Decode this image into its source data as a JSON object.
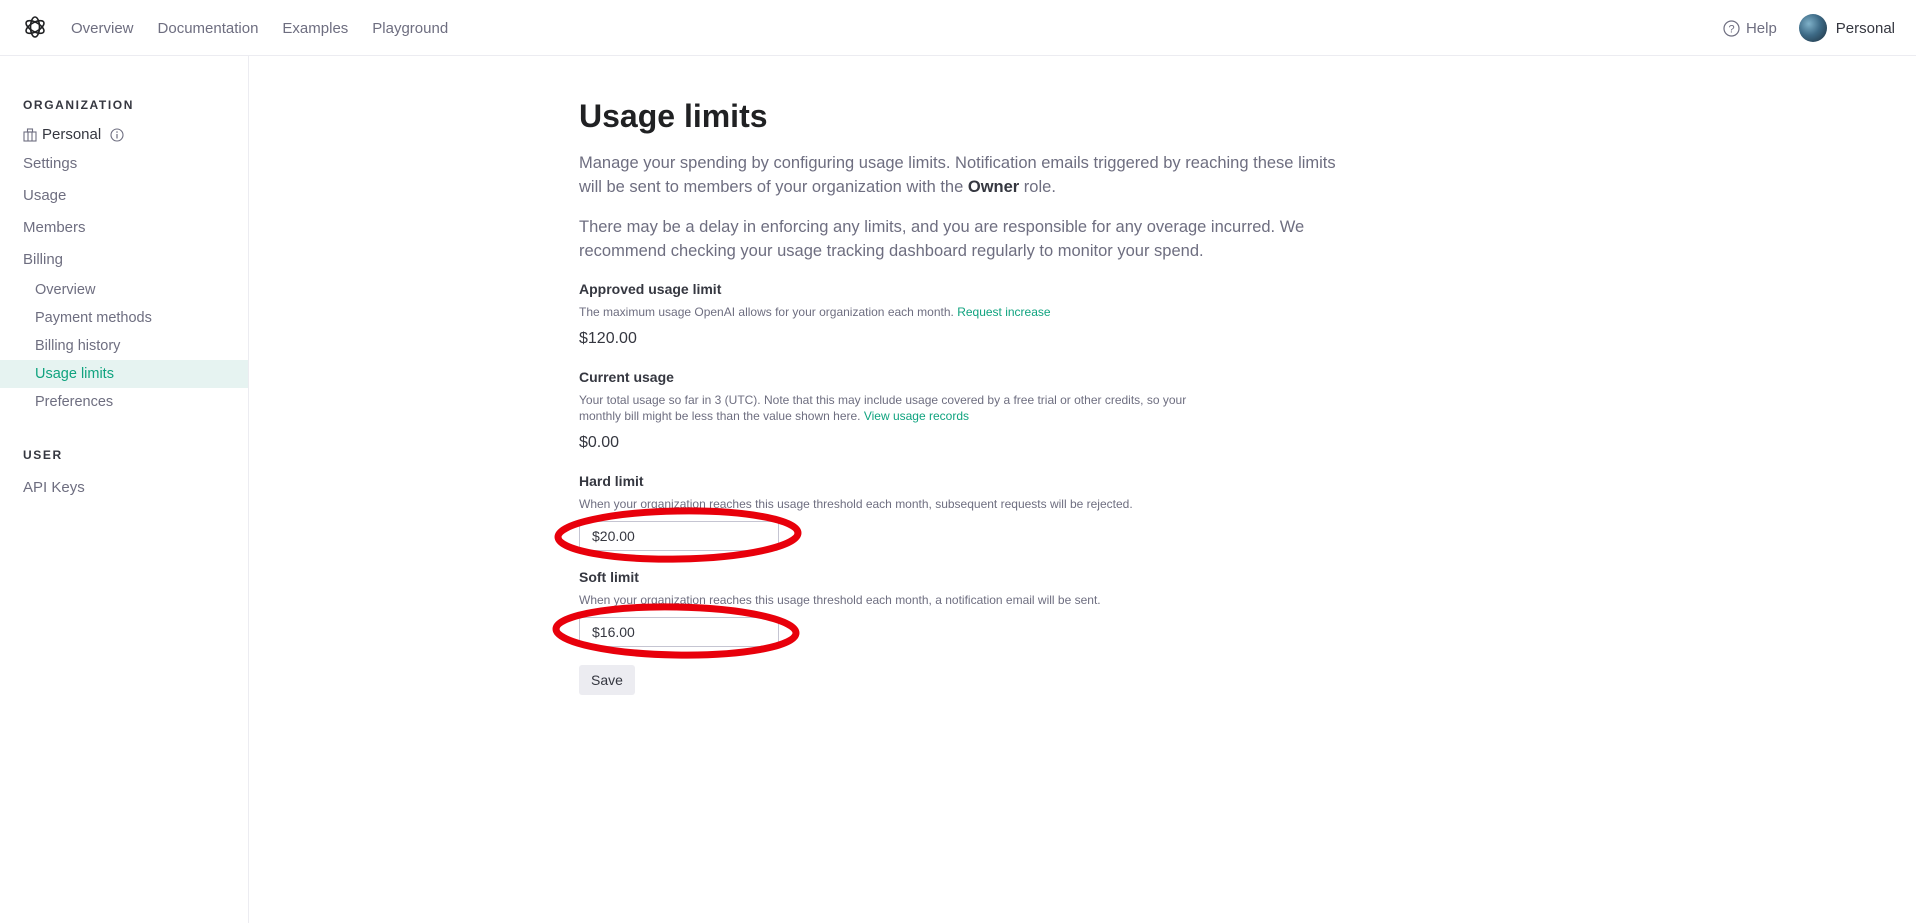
{
  "nav": {
    "links": [
      "Overview",
      "Documentation",
      "Examples",
      "Playground"
    ],
    "help": "Help",
    "account": "Personal"
  },
  "sidebar": {
    "org_title": "ORGANIZATION",
    "org_name": "Personal",
    "items": [
      "Settings",
      "Usage",
      "Members",
      "Billing"
    ],
    "billing_items": [
      "Overview",
      "Payment methods",
      "Billing history",
      "Usage limits",
      "Preferences"
    ],
    "active_item": "Usage limits",
    "user_title": "USER",
    "user_items": [
      "API Keys"
    ]
  },
  "page": {
    "title": "Usage limits",
    "intro_1_a": "Manage your spending by configuring usage limits. Notification emails triggered by reaching these limits will be sent to members of your organization with the ",
    "intro_1_bold": "Owner",
    "intro_1_b": " role.",
    "intro_2": "There may be a delay in enforcing any limits, and you are responsible for any overage incurred. We recommend checking your usage tracking dashboard regularly to monitor your spend.",
    "approved": {
      "label": "Approved usage limit",
      "desc": "The maximum usage OpenAI allows for your organization each month. ",
      "link": "Request increase",
      "value": "$120.00"
    },
    "current": {
      "label": "Current usage",
      "desc": "Your total usage so far in 3 (UTC). Note that this may include usage covered by a free trial or other credits, so your monthly bill might be less than the value shown here. ",
      "link": "View usage records",
      "value": "$0.00"
    },
    "hard": {
      "label": "Hard limit",
      "desc": "When your organization reaches this usage threshold each month, subsequent requests will be rejected.",
      "value": "$20.00"
    },
    "soft": {
      "label": "Soft limit",
      "desc": "When your organization reaches this usage threshold each month, a notification email will be sent.",
      "value": "$16.00"
    },
    "save_label": "Save"
  },
  "colors": {
    "accent": "#10a37f",
    "annotation": "#e8000b"
  }
}
